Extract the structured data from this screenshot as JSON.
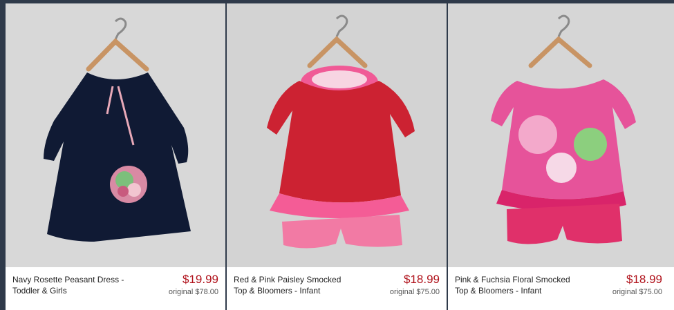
{
  "products": [
    {
      "title_line1": "Navy Rosette Peasant Dress -",
      "title_line2": "Toddler & Girls",
      "price": "$19.99",
      "original": "original $78.00"
    },
    {
      "title_line1": "Red & Pink Paisley Smocked",
      "title_line2": "Top & Bloomers - Infant",
      "price": "$18.99",
      "original": "original $75.00"
    },
    {
      "title_line1": "Pink & Fuchsia Floral Smocked",
      "title_line2": "Top & Bloomers - Infant",
      "price": "$18.99",
      "original": "original $75.00"
    }
  ]
}
